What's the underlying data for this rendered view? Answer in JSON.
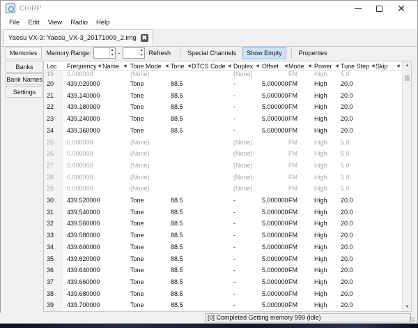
{
  "window": {
    "title": "CHIRP"
  },
  "menu": [
    "File",
    "Edit",
    "View",
    "Radio",
    "Help"
  ],
  "file_tab": {
    "label": "Yaesu VX-3: Yaesu_VX-3_20171009_2.img"
  },
  "toolbar": {
    "memories_tab": "Memories",
    "memory_range_label": "Memory Range:",
    "range_from": "",
    "range_dash": "-",
    "range_to": "",
    "refresh": "Refresh",
    "special_channels": "Special Channels",
    "show_empty": "Show Empty",
    "properties": "Properties"
  },
  "side_tabs": [
    "Banks",
    "Bank Names",
    "Settings"
  ],
  "columns": [
    "Loc",
    "Frequency",
    "Name",
    "Tone Mode",
    "Tone",
    "DTCS Code",
    "Duplex",
    "Offset",
    "Mode",
    "Power",
    "Tune Step",
    "Skip"
  ],
  "rows": [
    {
      "loc": "19",
      "freq": "0.000000",
      "name": "",
      "tmode": "(None)",
      "tone": "",
      "dtcs": "",
      "duplex": "(None)",
      "offset": "",
      "mode": "FM",
      "power": "High",
      "step": "5.0",
      "skip": "",
      "empty": true
    },
    {
      "loc": "20",
      "freq": "439.020000",
      "name": "",
      "tmode": "Tone",
      "tone": "88.5",
      "dtcs": "",
      "duplex": "-",
      "offset": "5.000000",
      "mode": "FM",
      "power": "High",
      "step": "20.0",
      "skip": "",
      "empty": false
    },
    {
      "loc": "21",
      "freq": "439.140000",
      "name": "",
      "tmode": "Tone",
      "tone": "88.5",
      "dtcs": "",
      "duplex": "-",
      "offset": "5.000000",
      "mode": "FM",
      "power": "High",
      "step": "20.0",
      "skip": "",
      "empty": false
    },
    {
      "loc": "22",
      "freq": "439.180000",
      "name": "",
      "tmode": "Tone",
      "tone": "88.5",
      "dtcs": "",
      "duplex": "-",
      "offset": "5.000000",
      "mode": "FM",
      "power": "High",
      "step": "20.0",
      "skip": "",
      "empty": false
    },
    {
      "loc": "23",
      "freq": "439.240000",
      "name": "",
      "tmode": "Tone",
      "tone": "88.5",
      "dtcs": "",
      "duplex": "-",
      "offset": "5.000000",
      "mode": "FM",
      "power": "High",
      "step": "20.0",
      "skip": "",
      "empty": false
    },
    {
      "loc": "24",
      "freq": "439.360000",
      "name": "",
      "tmode": "Tone",
      "tone": "88.5",
      "dtcs": "",
      "duplex": "-",
      "offset": "5.000000",
      "mode": "FM",
      "power": "High",
      "step": "20.0",
      "skip": "",
      "empty": false
    },
    {
      "loc": "25",
      "freq": "0.000000",
      "name": "",
      "tmode": "(None)",
      "tone": "",
      "dtcs": "",
      "duplex": "(None)",
      "offset": "",
      "mode": "FM",
      "power": "High",
      "step": "5.0",
      "skip": "",
      "empty": true
    },
    {
      "loc": "26",
      "freq": "0.000000",
      "name": "",
      "tmode": "(None)",
      "tone": "",
      "dtcs": "",
      "duplex": "(None)",
      "offset": "",
      "mode": "FM",
      "power": "High",
      "step": "5.0",
      "skip": "",
      "empty": true
    },
    {
      "loc": "27",
      "freq": "0.000000",
      "name": "",
      "tmode": "(None)",
      "tone": "",
      "dtcs": "",
      "duplex": "(None)",
      "offset": "",
      "mode": "FM",
      "power": "High",
      "step": "5.0",
      "skip": "",
      "empty": true
    },
    {
      "loc": "28",
      "freq": "0.000000",
      "name": "",
      "tmode": "(None)",
      "tone": "",
      "dtcs": "",
      "duplex": "(None)",
      "offset": "",
      "mode": "FM",
      "power": "High",
      "step": "5.0",
      "skip": "",
      "empty": true
    },
    {
      "loc": "29",
      "freq": "0.000000",
      "name": "",
      "tmode": "(None)",
      "tone": "",
      "dtcs": "",
      "duplex": "(None)",
      "offset": "",
      "mode": "FM",
      "power": "High",
      "step": "5.0",
      "skip": "",
      "empty": true
    },
    {
      "loc": "30",
      "freq": "439.520000",
      "name": "",
      "tmode": "Tone",
      "tone": "88.5",
      "dtcs": "",
      "duplex": "-",
      "offset": "5.000000",
      "mode": "FM",
      "power": "High",
      "step": "20.0",
      "skip": "",
      "empty": false
    },
    {
      "loc": "31",
      "freq": "439.540000",
      "name": "",
      "tmode": "Tone",
      "tone": "88.5",
      "dtcs": "",
      "duplex": "-",
      "offset": "5.000000",
      "mode": "FM",
      "power": "High",
      "step": "20.0",
      "skip": "",
      "empty": false
    },
    {
      "loc": "32",
      "freq": "439.560000",
      "name": "",
      "tmode": "Tone",
      "tone": "88.5",
      "dtcs": "",
      "duplex": "-",
      "offset": "5.000000",
      "mode": "FM",
      "power": "High",
      "step": "20.0",
      "skip": "",
      "empty": false
    },
    {
      "loc": "33",
      "freq": "439.580000",
      "name": "",
      "tmode": "Tone",
      "tone": "88.5",
      "dtcs": "",
      "duplex": "-",
      "offset": "5.000000",
      "mode": "FM",
      "power": "High",
      "step": "20.0",
      "skip": "",
      "empty": false
    },
    {
      "loc": "34",
      "freq": "439.600000",
      "name": "",
      "tmode": "Tone",
      "tone": "88.5",
      "dtcs": "",
      "duplex": "-",
      "offset": "5.000000",
      "mode": "FM",
      "power": "High",
      "step": "20.0",
      "skip": "",
      "empty": false
    },
    {
      "loc": "35",
      "freq": "439.620000",
      "name": "",
      "tmode": "Tone",
      "tone": "88.5",
      "dtcs": "",
      "duplex": "-",
      "offset": "5.000000",
      "mode": "FM",
      "power": "High",
      "step": "20.0",
      "skip": "",
      "empty": false
    },
    {
      "loc": "36",
      "freq": "439.640000",
      "name": "",
      "tmode": "Tone",
      "tone": "88.5",
      "dtcs": "",
      "duplex": "-",
      "offset": "5.000000",
      "mode": "FM",
      "power": "High",
      "step": "20.0",
      "skip": "",
      "empty": false
    },
    {
      "loc": "37",
      "freq": "439.660000",
      "name": "",
      "tmode": "Tone",
      "tone": "88.5",
      "dtcs": "",
      "duplex": "-",
      "offset": "5.000000",
      "mode": "FM",
      "power": "High",
      "step": "20.0",
      "skip": "",
      "empty": false
    },
    {
      "loc": "38",
      "freq": "439.680000",
      "name": "",
      "tmode": "Tone",
      "tone": "88.5",
      "dtcs": "",
      "duplex": "-",
      "offset": "5.000000",
      "mode": "FM",
      "power": "High",
      "step": "20.0",
      "skip": "",
      "empty": false
    },
    {
      "loc": "39",
      "freq": "439.700000",
      "name": "",
      "tmode": "Tone",
      "tone": "88.5",
      "dtcs": "",
      "duplex": "-",
      "offset": "5.000000",
      "mode": "FM",
      "power": "High",
      "step": "20.0",
      "skip": "",
      "empty": false
    }
  ],
  "status": {
    "text": "[0] Completed Getting memory 999 (idle)"
  }
}
